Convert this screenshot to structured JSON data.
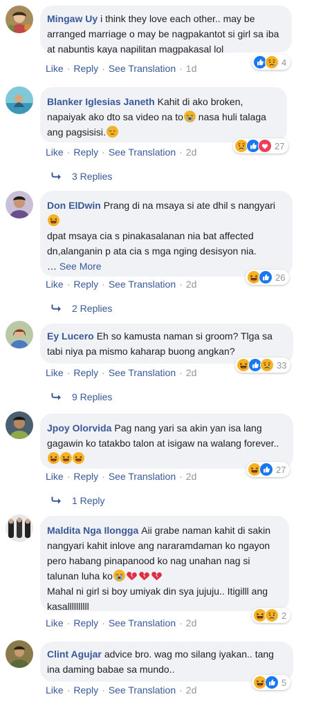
{
  "ui": {
    "like": "Like",
    "reply": "Reply",
    "see_translation": "See Translation",
    "dot": "·",
    "see_more": "See More",
    "ellipsis": "…"
  },
  "colors": {
    "link": "#385898",
    "bubble": "#f0f2f5",
    "meta": "#90949c",
    "like_blue": "#1877f2",
    "love_red": "#f33e58",
    "emoji_yellow": "#f7b125"
  },
  "comments": [
    {
      "author": "Mingaw Uy",
      "text": "i think they love each other.. may be arranged marriage o may be nagpakantot si girl sa iba at nabuntis kaya napilitan magpakasal lol",
      "time": "1d",
      "reactions": [
        "like-icon",
        "sad-icon"
      ],
      "reaction_count": "4"
    },
    {
      "author": "Blanker Iglesias Janeth",
      "text": "Kahit di ako broken, napaiyak ako dto sa video na to",
      "text2": " nasa huli talaga ang pagsisisi.",
      "time": "2d",
      "reactions": [
        "sad-icon",
        "like-icon",
        "love-icon"
      ],
      "reaction_count": "27",
      "replies": "3 Replies"
    },
    {
      "author": "Don ElDwin",
      "text": "Prang di na msaya si ate dhil s nangyari",
      "text2": "dpat msaya cia s pinakasalanan nia bat affected dn,alanganin p ata cia s mga nging desisyon nia.",
      "time": "2d",
      "reactions": [
        "haha-icon",
        "like-icon"
      ],
      "reaction_count": "26",
      "replies": "2 Replies"
    },
    {
      "author": "Ey Lucero",
      "text": "Eh so kamusta naman si groom? Tlga sa tabi niya pa mismo kaharap buong angkan?",
      "time": "2d",
      "reactions": [
        "haha-icon",
        "like-icon",
        "sad-icon"
      ],
      "reaction_count": "33",
      "replies": "9 Replies"
    },
    {
      "author": "Jpoy Olorvida",
      "text": "Pag nang yari sa akin yan isa lang gagawin ko tatakbo talon at isigaw na walang forever..",
      "time": "2d",
      "reactions": [
        "haha-icon",
        "like-icon"
      ],
      "reaction_count": "27",
      "replies": "1 Reply"
    },
    {
      "author": "Maldita Nga Ilongga",
      "text": "Aii grabe naman kahit di sakin nangyari kahit inlove ang nararamdaman ko ngayon pero habang pinapanood ko nag unahan nag si talunan luha ko",
      "text2": "Mahal ni girl si boy umiyak din sya jujuju.. Itigilll ang kasallllllllll",
      "time": "2d",
      "reactions": [
        "haha-icon",
        "sad-icon"
      ],
      "reaction_count": "2"
    },
    {
      "author": "Clint Agujar",
      "text": "advice bro. wag mo silang iyakan.. tang ina daming babae sa mundo..",
      "time": "2d",
      "reactions": [
        "haha-icon",
        "like-icon"
      ],
      "reaction_count": "5"
    }
  ]
}
